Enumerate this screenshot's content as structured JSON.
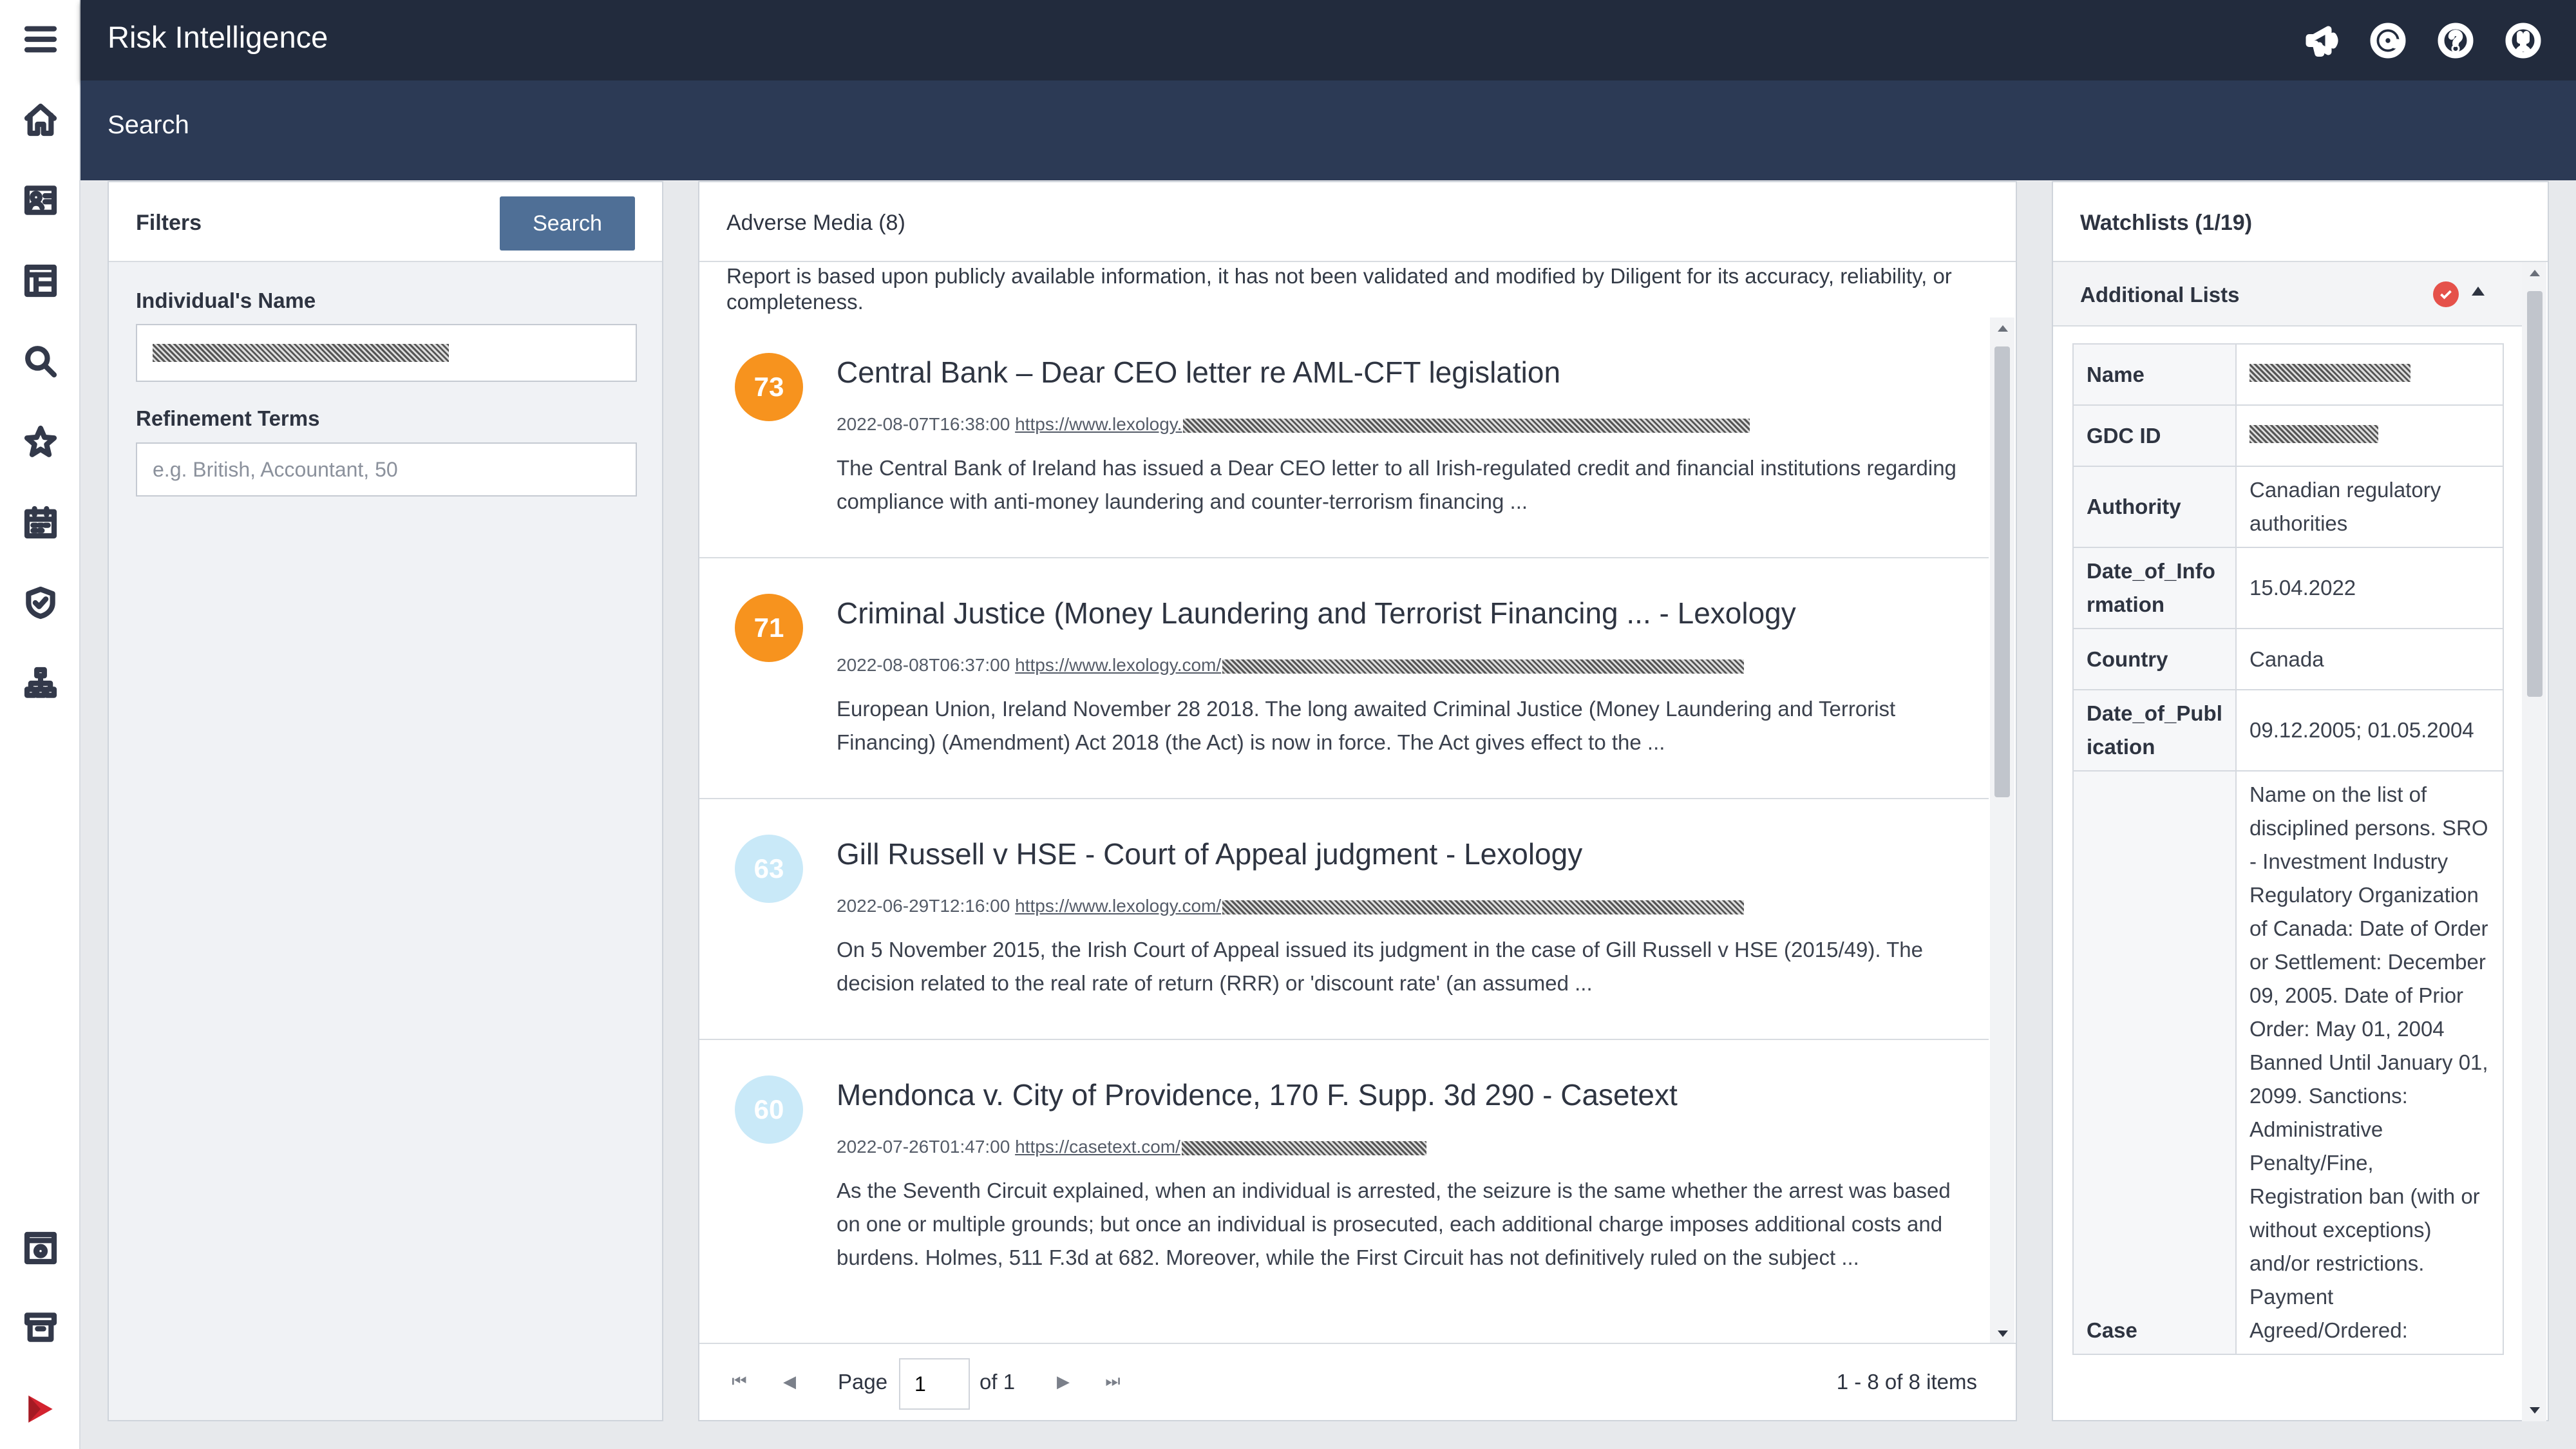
{
  "app": {
    "title": "Risk Intelligence"
  },
  "page": {
    "title": "Search"
  },
  "sidebar": {
    "icons": [
      "menu-icon",
      "home-icon",
      "id-card-icon",
      "table-icon",
      "search-icon",
      "star-icon",
      "calendar-icon",
      "shield-check-icon",
      "org-chart-icon",
      "settings-panel-icon",
      "archive-icon",
      "diligent-logo"
    ]
  },
  "topbar": {
    "icons": [
      "megaphone-icon",
      "at-sign-icon",
      "help-icon",
      "user-icon"
    ]
  },
  "filters": {
    "title": "Filters",
    "search_label": "Search",
    "name_label": "Individual's Name",
    "name_value": "",
    "refinement_label": "Refinement Terms",
    "refinement_placeholder": "e.g. British, Accountant, 50"
  },
  "adverse_media": {
    "title": "Adverse Media (8)",
    "disclaimer": "Report is based upon publicly available information, it has not been validated and modified by Diligent for its accuracy, reliability, or completeness.",
    "results": [
      {
        "score": "73",
        "score_color": "#f7931e",
        "title": "Central Bank – Dear CEO letter re AML-CFT legislation",
        "date": "2022-08-07T16:38:00",
        "url": "https://www.lexology.",
        "snippet": "The Central Bank of Ireland has issued a Dear CEO letter to all Irish-regulated credit and financial institutions regarding compliance with anti-money laundering and counter-terrorism financing ..."
      },
      {
        "score": "71",
        "score_color": "#f7931e",
        "title": "Criminal Justice (Money Laundering and Terrorist Financing ... - Lexology",
        "date": "2022-08-08T06:37:00",
        "url": "https://www.lexology.com/",
        "snippet": "European Union, Ireland November 28 2018. The long awaited Criminal Justice (Money Laundering and Terrorist Financing) (Amendment) Act 2018 (the Act) is now in force. The Act gives effect to the ..."
      },
      {
        "score": "63",
        "score_color": "#c9e9f8",
        "title": "Gill Russell v HSE - Court of Appeal judgment - Lexology",
        "date": "2022-06-29T12:16:00",
        "url": "https://www.lexology.com/",
        "snippet": "On 5 November 2015, the Irish Court of Appeal issued its judgment in the case of Gill Russell v HSE (2015/49). The decision related to the real rate of return (RRR) or 'discount rate' (an assumed ..."
      },
      {
        "score": "60",
        "score_color": "#c9e9f8",
        "title": "Mendonca v. City of Providence, 170 F. Supp. 3d 290 - Casetext",
        "date": "2022-07-26T01:47:00",
        "url": "https://casetext.com/",
        "snippet": "As the Seventh Circuit explained, when an individual is arrested, the seizure is the same whether the arrest was based on one or multiple grounds; but once an individual is prosecuted, each additional charge imposes additional costs and burdens. Holmes, 511 F.3d at 682. Moreover, while the First Circuit has not definitively ruled on the subject ..."
      }
    ],
    "pager": {
      "page_label": "Page",
      "page_value": "1",
      "of_label": "of 1",
      "items_label": "1 - 8 of 8 items"
    }
  },
  "watchlists": {
    "title": "Watchlists (1/19)",
    "section_label": "Additional Lists",
    "rows": [
      {
        "key": "Name",
        "value": ""
      },
      {
        "key": "GDC ID",
        "value": ""
      },
      {
        "key": "Authority",
        "value": "Canadian regulatory authorities"
      },
      {
        "key": "Date_of_Information",
        "value": "15.04.2022"
      },
      {
        "key": "Country",
        "value": "Canada"
      },
      {
        "key": "Date_of_Publication",
        "value": "09.12.2005; 01.05.2004"
      },
      {
        "key": "Case",
        "value": "Name on the list of disciplined persons. SRO - Investment Industry Regulatory Organization of Canada: Date of Order or Settlement: December 09, 2005. Date of Prior Order: May 01, 2004 Banned Until January 01, 2099. Sanctions: Administrative Penalty/Fine, Registration ban (with or without exceptions) and/or restrictions. Payment Agreed/Ordered:"
      }
    ]
  }
}
